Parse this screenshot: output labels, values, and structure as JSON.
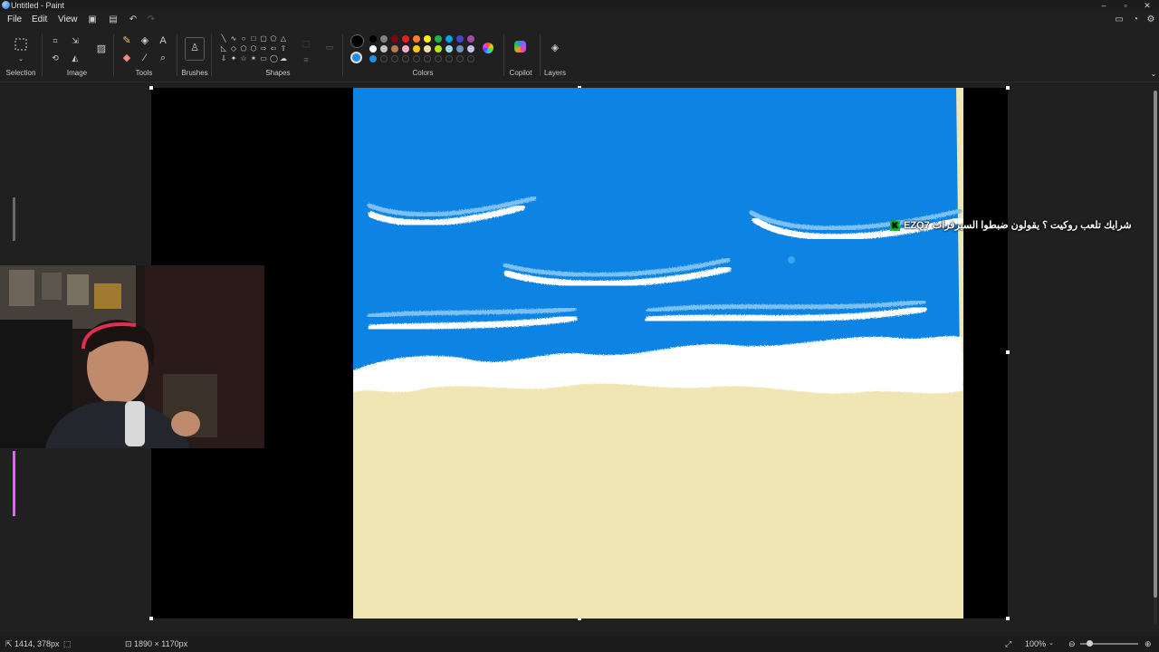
{
  "window": {
    "title": "Untitled - Paint"
  },
  "menu": {
    "file": "File",
    "edit": "Edit",
    "view": "View"
  },
  "ribbon": {
    "groups": {
      "selection": "Selection",
      "image": "Image",
      "tools": "Tools",
      "brushes": "Brushes",
      "shapes": "Shapes",
      "colors": "Colors",
      "copilot": "Copilot",
      "layers": "Layers"
    },
    "colors": {
      "primary": "#000000",
      "secondary": "#1e8ee6",
      "row1": [
        "#000000",
        "#7f7f7f",
        "#880015",
        "#ed1c24",
        "#ff7f27",
        "#fff200",
        "#22b14c",
        "#00a2e8",
        "#3f48cc",
        "#a349a4"
      ],
      "row2": [
        "#ffffff",
        "#c3c3c3",
        "#b97a57",
        "#ffaec9",
        "#ffc90e",
        "#efe4b0",
        "#b5e61d",
        "#99d9ea",
        "#7092be",
        "#c8bfe7"
      ],
      "sky": "#0d84e4",
      "sand": "#efe6b4"
    }
  },
  "overlay": {
    "chat_user": "EZQ7",
    "chat_message": "شرايك تلعب روكيت ؟ يقولون ضبطوا السيرفرات"
  },
  "status": {
    "cursor_position": "1414, 378px",
    "canvas_size": "1890 × 1170px",
    "zoom": "100%"
  }
}
